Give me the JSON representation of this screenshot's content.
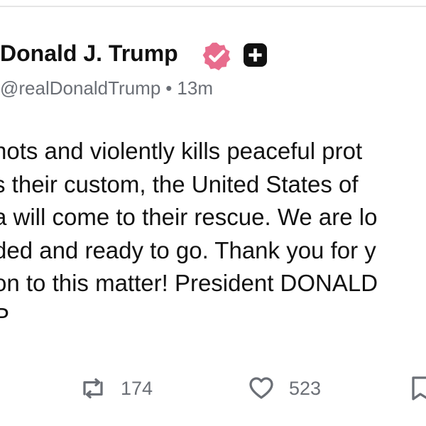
{
  "post": {
    "author": {
      "display_name": "Donald J. Trump",
      "handle": "@realDonaldTrump",
      "separator": "•",
      "timestamp": "13m"
    },
    "body_lines": [
      "hots and violently kills peaceful prot",
      "s their custom, the United States of",
      "a will come to their rescue. We are lo",
      "ded and ready to go. Thank you for y",
      "on to this matter! President DONALD",
      "P"
    ],
    "actions": {
      "reposts": "174",
      "likes": "523"
    }
  },
  "icons": {
    "verified": "verified-badge-icon",
    "add": "plus-icon",
    "repost": "repost-icon",
    "like": "heart-icon",
    "bookmark": "bookmark-icon"
  },
  "colors": {
    "verified_badge": "#e86c8d",
    "text": "#111111",
    "muted_text": "#6b6f76",
    "divider": "#e6e6e6"
  }
}
